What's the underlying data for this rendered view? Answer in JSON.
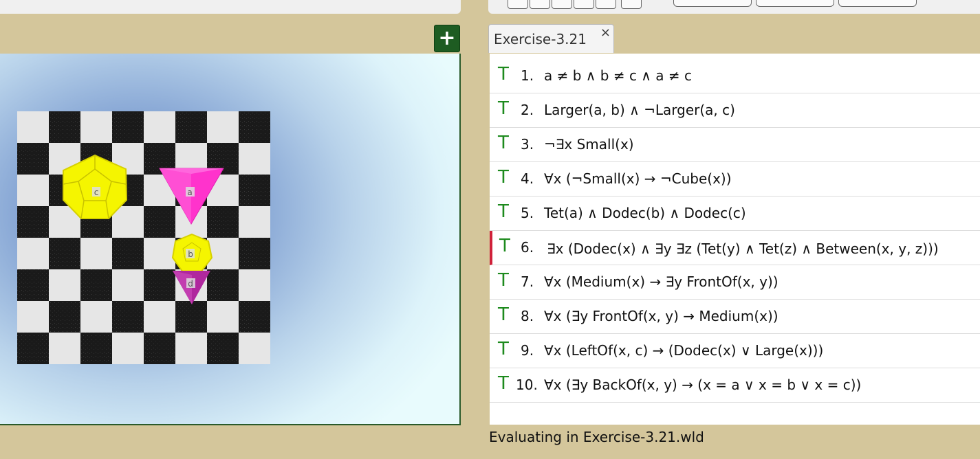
{
  "tab": {
    "label": "Exercise-3.21",
    "close": "×"
  },
  "add_button": {
    "label": "+"
  },
  "world": {
    "objects": [
      {
        "name": "c",
        "shape": "dodecahedron",
        "size": "large",
        "color": "#f5f500"
      },
      {
        "name": "a",
        "shape": "tetrahedron",
        "size": "large",
        "color": "#ff33cc"
      },
      {
        "name": "b",
        "shape": "dodecahedron",
        "size": "medium",
        "color": "#f5f500"
      },
      {
        "name": "d",
        "shape": "tetrahedron",
        "size": "small",
        "color": "#b0279e"
      }
    ]
  },
  "sentences": [
    {
      "truth": "T",
      "num": "1.",
      "formula": "a ≠ b ∧ b ≠ c ∧ a ≠ c"
    },
    {
      "truth": "T",
      "num": "2.",
      "formula": "Larger(a, b) ∧ ¬Larger(a, c)"
    },
    {
      "truth": "T",
      "num": "3.",
      "formula": "¬∃x Small(x)"
    },
    {
      "truth": "T",
      "num": "4.",
      "formula": "∀x (¬Small(x) → ¬Cube(x))"
    },
    {
      "truth": "T",
      "num": "5.",
      "formula": "Tet(a) ∧ Dodec(b) ∧ Dodec(c)"
    },
    {
      "truth": "T",
      "num": "6.",
      "formula": "∃x (Dodec(x) ∧ ∃y ∃z (Tet(y) ∧ Tet(z) ∧ Between(x, y, z)))",
      "selected": true
    },
    {
      "truth": "T",
      "num": "7.",
      "formula": "∀x (Medium(x) → ∃y FrontOf(x, y))"
    },
    {
      "truth": "T",
      "num": "8.",
      "formula": "∀x (∃y FrontOf(x, y) → Medium(x))"
    },
    {
      "truth": "T",
      "num": "9.",
      "formula": "∀x (LeftOf(x, c) → (Dodec(x) ∨ Large(x)))"
    },
    {
      "truth": "T",
      "num": "10.",
      "formula": "∀x (∃y BackOf(x, y) → (x = a ∨ x = b ∨ x = c))"
    }
  ],
  "status": "Evaluating in Exercise-3.21.wld",
  "colors": {
    "true": "#1d8a1d",
    "selected_marker": "#d0213a",
    "add_button": "#1e5c22"
  }
}
